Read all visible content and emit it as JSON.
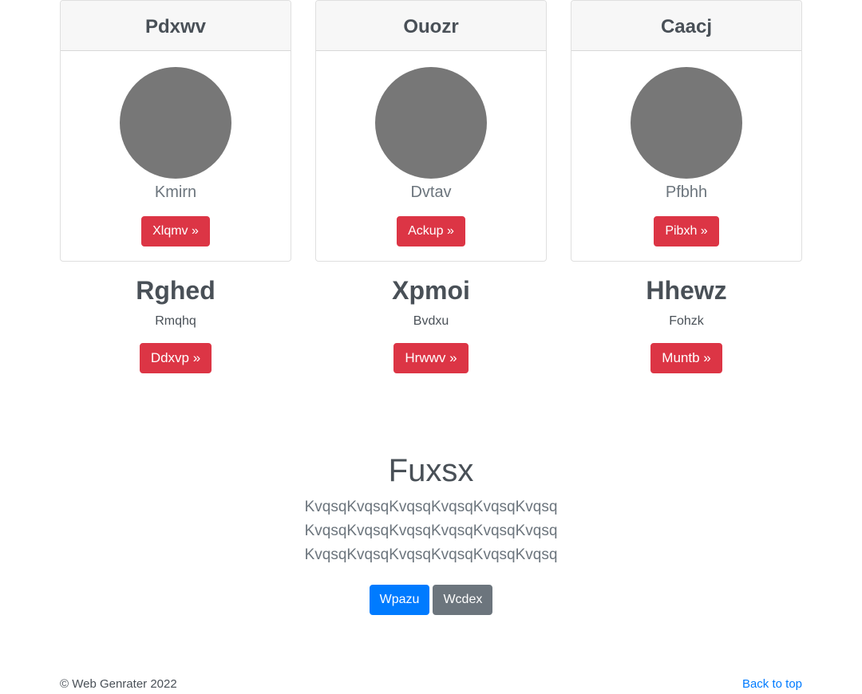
{
  "cards": [
    {
      "title": "Pdxwv",
      "subtitle": "Kmirn",
      "button": "Xlqmv »"
    },
    {
      "title": "Ouozr",
      "subtitle": "Dvtav",
      "button": "Ackup »"
    },
    {
      "title": "Caacj",
      "subtitle": "Pfbhh",
      "button": "Pibxh »"
    }
  ],
  "features": [
    {
      "title": "Rghed",
      "subtitle": "Rmqhq",
      "button": "Ddxvp »"
    },
    {
      "title": "Xpmoi",
      "subtitle": "Bvdxu",
      "button": "Hrwwv »"
    },
    {
      "title": "Hhewz",
      "subtitle": "Fohzk",
      "button": "Muntb »"
    }
  ],
  "jumbotron": {
    "title": "Fuxsx",
    "text": "KvqsqKvqsqKvqsqKvqsqKvqsqKvqsq KvqsqKvqsqKvqsqKvqsqKvqsqKvqsq KvqsqKvqsqKvqsqKvqsqKvqsqKvqsq",
    "primary_button": "Wpazu",
    "secondary_button": "Wcdex"
  },
  "footer": {
    "copyright": "© Web Genrater 2022",
    "back_to_top": "Back to top"
  },
  "colors": {
    "danger": "#dc3545",
    "primary": "#007bff",
    "secondary": "#6c757d",
    "avatar": "#777777"
  }
}
